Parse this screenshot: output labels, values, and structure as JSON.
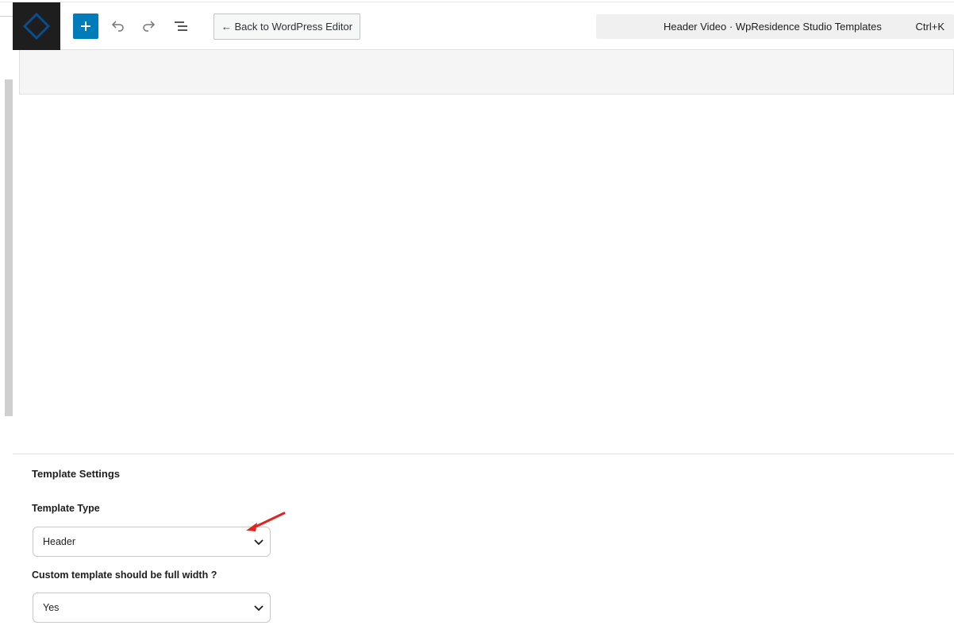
{
  "toolbar": {
    "logo_icon": "diamond-logo-icon",
    "add_block_icon": "plus-icon",
    "undo_icon": "undo-icon",
    "redo_icon": "redo-icon",
    "list_view_icon": "list-view-icon",
    "back_label": "← Back to WordPress Editor",
    "document_title": "Header Video · WpResidence Studio Templates",
    "shortcut": "Ctrl+K"
  },
  "template_settings": {
    "title": "Template Settings",
    "template_type": {
      "label": "Template Type",
      "value": "Header"
    },
    "full_width": {
      "label": "Custom template should be full width ?",
      "value": "Yes"
    }
  },
  "colors": {
    "accent": "#007cba",
    "logo_bg": "#1e1e1e",
    "arrow": "#e3231f"
  }
}
